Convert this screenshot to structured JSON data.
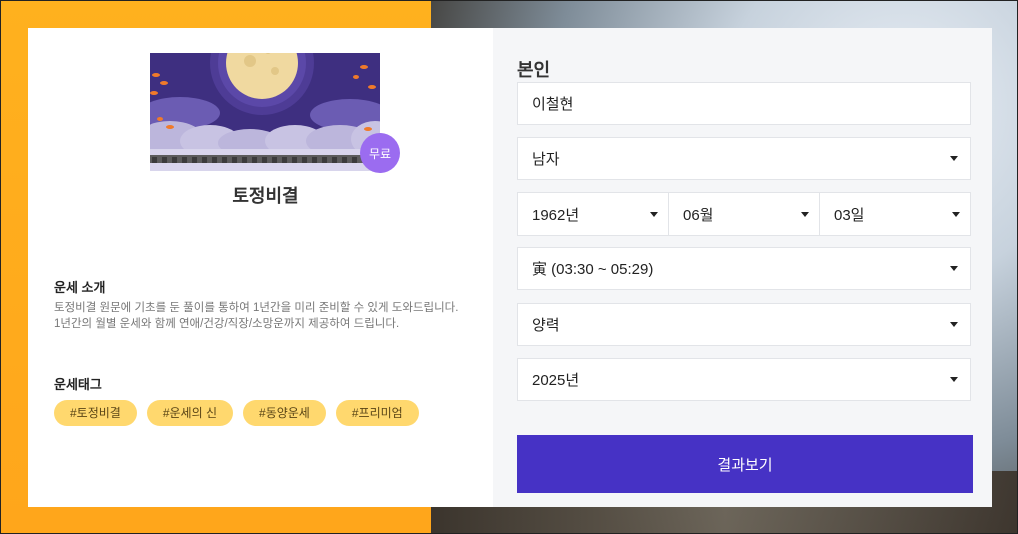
{
  "card": {
    "title": "토정비결",
    "free_badge": "무료",
    "intro_title": "운세 소개",
    "intro_text": "토정비결 원문에 기초를 둔 풀이를 통하여 1년간을 미리 준비할 수 있게 도와드립니다.\n1년간의 월별 운세와 함께 연애/건강/직장/소망운까지 제공하여 드립니다.",
    "tags_title": "운세태그",
    "tags": [
      "#토정비결",
      "#운세의 신",
      "#동양운세",
      "#프리미엄"
    ]
  },
  "form": {
    "person_label": "본인",
    "name_value": "이철현",
    "gender_value": "남자",
    "year_value": "1962년",
    "month_value": "06월",
    "day_value": "03일",
    "time_value": "寅 (03:30 ~ 05:29)",
    "calendar_value": "양력",
    "target_year_value": "2025년",
    "submit_label": "결과보기"
  },
  "colors": {
    "accent": "#4632c5",
    "tag_bg": "#ffd86e",
    "badge_bg": "#9b6cf0",
    "bg_orange": "#ffb11e"
  }
}
